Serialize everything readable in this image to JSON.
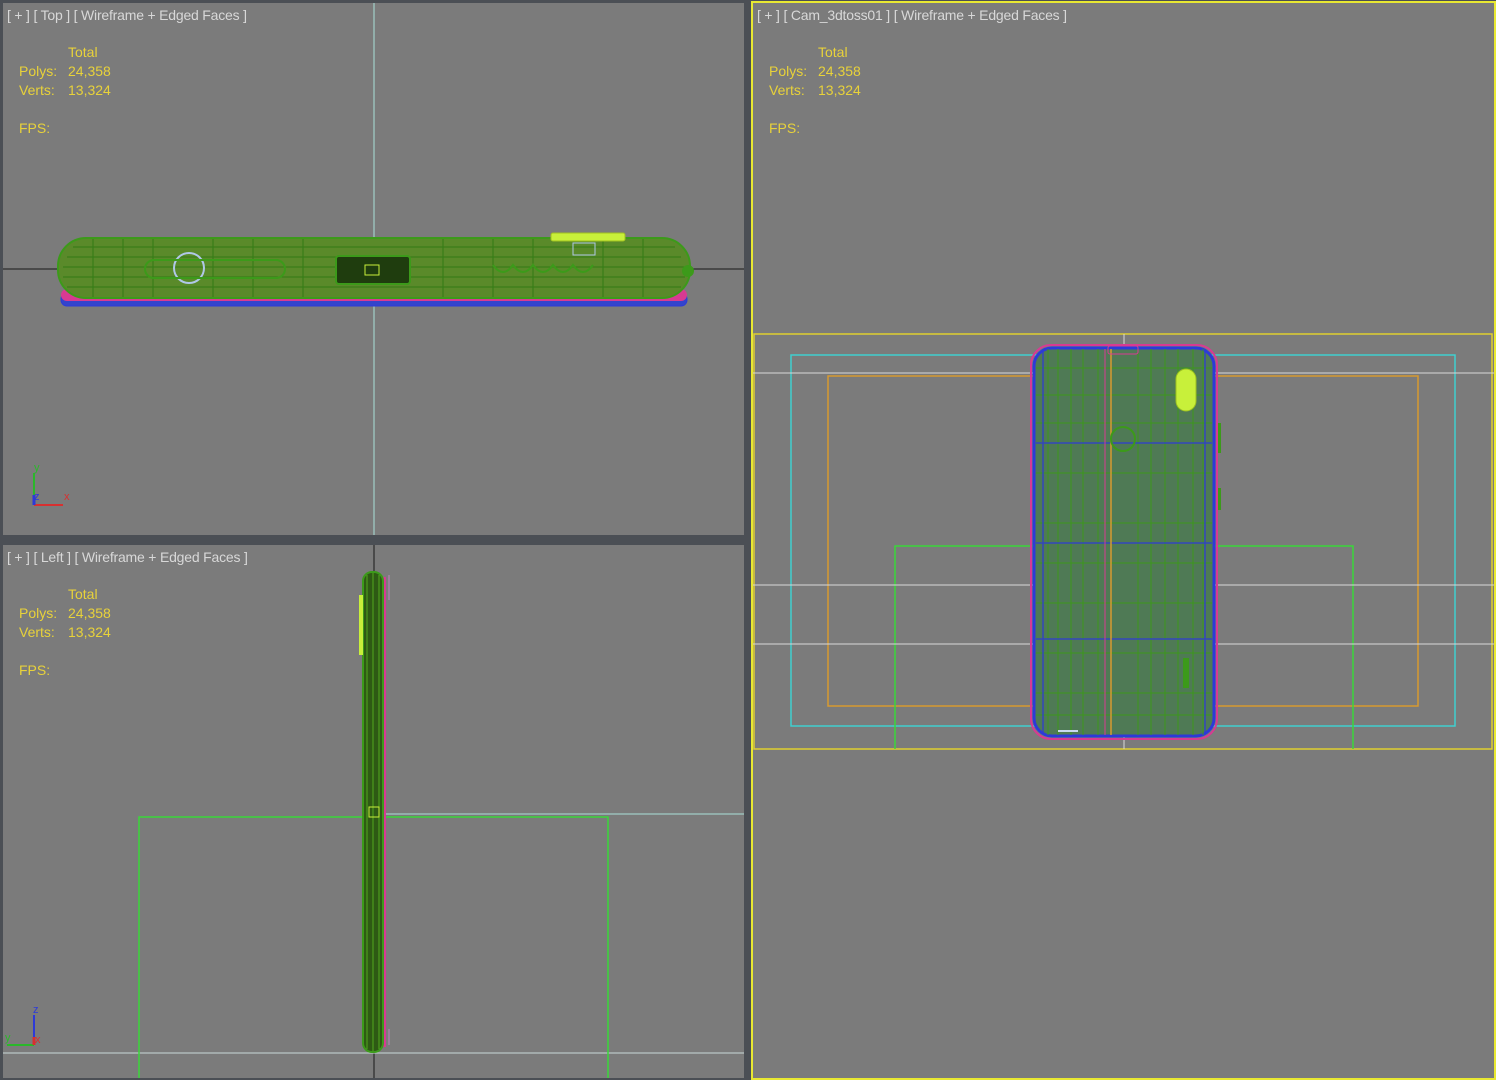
{
  "viewports": {
    "top": {
      "label_plus": "[ + ]",
      "label_view": "[ Top ]",
      "label_mode": "[ Wireframe + Edged Faces ]",
      "stats": {
        "header": "Total",
        "polys_label": "Polys:",
        "polys": "24,358",
        "verts_label": "Verts:",
        "verts": "13,324",
        "fps_label": "FPS:"
      },
      "axes": {
        "a": "y",
        "b": "z",
        "c": "x"
      }
    },
    "left": {
      "label_plus": "[ + ]",
      "label_view": "[ Left ]",
      "label_mode": "[ Wireframe + Edged Faces ]",
      "stats": {
        "header": "Total",
        "polys_label": "Polys:",
        "polys": "24,358",
        "verts_label": "Verts:",
        "verts": "13,324",
        "fps_label": "FPS:"
      },
      "axes": {
        "a": "z",
        "b": "y",
        "c": "x"
      }
    },
    "camera": {
      "label_plus": "[ + ]",
      "label_view": "[ Cam_3dtoss01 ]",
      "label_mode": "[ Wireframe + Edged Faces ]",
      "stats": {
        "header": "Total",
        "polys_label": "Polys:",
        "polys": "24,358",
        "verts_label": "Verts:",
        "verts": "13,324",
        "fps_label": "FPS:"
      }
    }
  },
  "colors": {
    "viewport_bg": "#7b7b7b",
    "active_border": "#e8e832",
    "stats_text": "#e8d23a",
    "wire_green": "#3c9a1a",
    "wire_blue": "#2d3ad8",
    "wire_pink": "#e0308c",
    "cyan_frame": "#3fd0d0",
    "orange_frame": "#d89a30",
    "yellow_frame": "#e0d030",
    "lime": "#c8f03a"
  }
}
